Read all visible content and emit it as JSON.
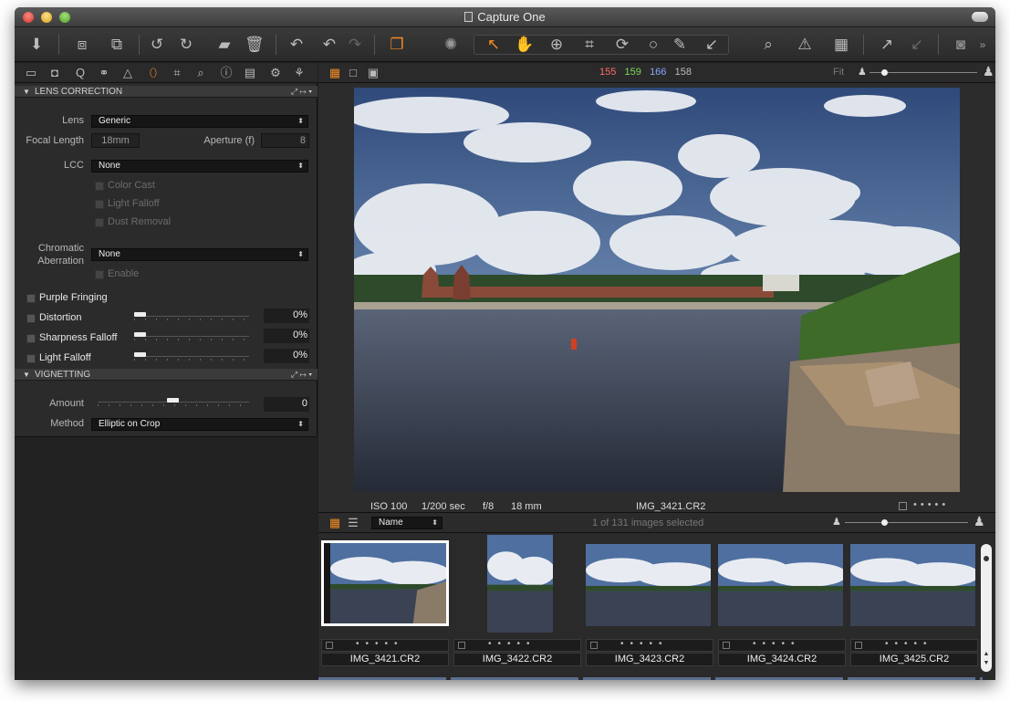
{
  "window": {
    "title": "Capture One"
  },
  "left_panel": {
    "lens_section": {
      "title": "LENS CORRECTION",
      "lens_label": "Lens",
      "lens_value": "Generic",
      "focal_label": "Focal Length",
      "focal_value": "18mm",
      "aperture_label": "Aperture (f)",
      "aperture_value": "8",
      "lcc_label": "LCC",
      "lcc_value": "None",
      "lcc_options": [
        "Color Cast",
        "Light Falloff",
        "Dust Removal"
      ],
      "ca_label_1": "Chromatic",
      "ca_label_2": "Aberration",
      "ca_value": "None",
      "ca_enable": "Enable",
      "purple_fringing": "Purple Fringing",
      "sliders": [
        {
          "label": "Distortion",
          "value": "0%"
        },
        {
          "label": "Sharpness Falloff",
          "value": "0%"
        },
        {
          "label": "Light Falloff",
          "value": "0%"
        }
      ]
    },
    "vignetting_section": {
      "title": "VIGNETTING",
      "amount_label": "Amount",
      "amount_value": "0",
      "method_label": "Method",
      "method_value": "Elliptic on Crop"
    }
  },
  "viewer": {
    "rgb": {
      "r": "155",
      "g": "159",
      "b": "166",
      "l": "158"
    },
    "zoom_label": "Fit",
    "meta": {
      "iso": "ISO 100",
      "shutter": "1/200 sec",
      "aperture": "f/8",
      "focal": "18 mm",
      "filename": "IMG_3421.CR2"
    }
  },
  "browser": {
    "sort_value": "Name",
    "selection_status": "1 of 131 images selected",
    "thumbnails": [
      {
        "name": "IMG_3421.CR2",
        "selected": true
      },
      {
        "name": "IMG_3422.CR2",
        "selected": false
      },
      {
        "name": "IMG_3423.CR2",
        "selected": false
      },
      {
        "name": "IMG_3424.CR2",
        "selected": false
      },
      {
        "name": "IMG_3425.CR2",
        "selected": false
      }
    ]
  },
  "colors": {
    "accent_orange": "#f08a24",
    "red": "#ff6b6b",
    "green": "#7ed957",
    "blue": "#8aa6ff"
  }
}
